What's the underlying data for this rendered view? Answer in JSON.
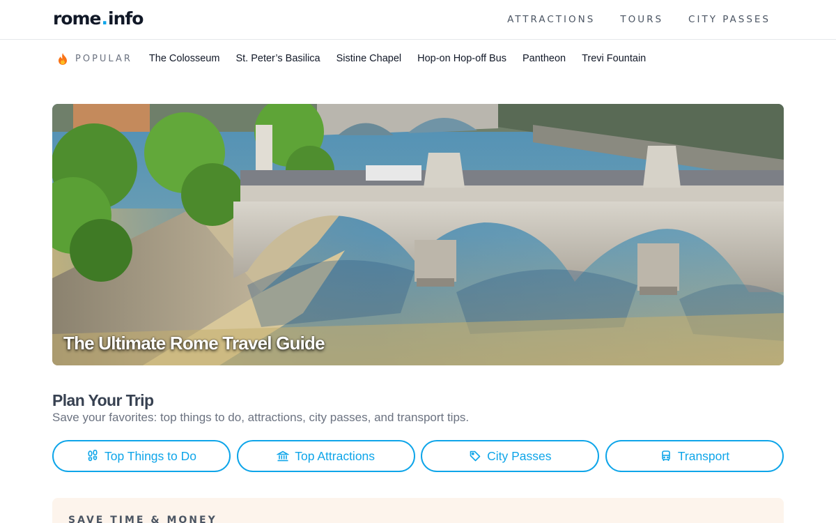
{
  "header": {
    "logo_part1": "rome",
    "logo_dot": ".",
    "logo_part2": "info",
    "nav": [
      "ATTRACTIONS",
      "TOURS",
      "CITY PASSES"
    ]
  },
  "popular": {
    "label": "POPULAR",
    "icon": "flame-icon",
    "links": [
      "The Colosseum",
      "St. Peter’s Basilica",
      "Sistine Chapel",
      "Hop-on Hop-off Bus",
      "Pantheon",
      "Trevi Fountain"
    ]
  },
  "hero": {
    "title": "The Ultimate Rome Travel Guide"
  },
  "plan": {
    "title": "Plan Your Trip",
    "subtitle": "Save your favorites: top things to do, attractions, city passes, and transport tips.",
    "buttons": [
      {
        "label": "Top Things to Do",
        "icon": "footprints-icon"
      },
      {
        "label": "Top Attractions",
        "icon": "landmark-icon"
      },
      {
        "label": "City Passes",
        "icon": "tag-icon"
      },
      {
        "label": "Transport",
        "icon": "bus-icon"
      }
    ]
  },
  "save_section": {
    "label": "SAVE TIME & MONEY"
  },
  "colors": {
    "accent": "#0ea5e9",
    "save_bg": "#fdf4ec"
  }
}
